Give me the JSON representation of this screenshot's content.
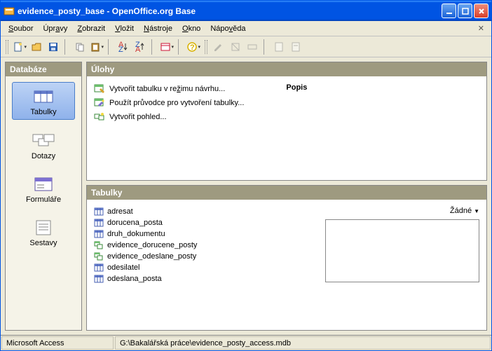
{
  "title": "evidence_posty_base - OpenOffice.org Base",
  "menubar": [
    "Soubor",
    "Úpravy",
    "Zobrazit",
    "Vložit",
    "Nástroje",
    "Okno",
    "Nápověda"
  ],
  "left": {
    "header": "Databáze",
    "items": [
      {
        "label": "Tabulky",
        "selected": true
      },
      {
        "label": "Dotazy"
      },
      {
        "label": "Formuláře"
      },
      {
        "label": "Sestavy"
      }
    ]
  },
  "tasks": {
    "header": "Úlohy",
    "items": [
      "Vytvořit tabulku v režimu návrhu...",
      "Použít průvodce pro vytvoření tabulky...",
      "Vytvořit pohled..."
    ],
    "popis_label": "Popis"
  },
  "tables": {
    "header": "Tabulky",
    "items": [
      {
        "name": "adresat",
        "type": "table"
      },
      {
        "name": "dorucena_posta",
        "type": "table"
      },
      {
        "name": "druh_dokumentu",
        "type": "table"
      },
      {
        "name": "evidence_dorucene_posty",
        "type": "query"
      },
      {
        "name": "evidence_odeslane_posty",
        "type": "query"
      },
      {
        "name": "odesilatel",
        "type": "table"
      },
      {
        "name": "odeslana_posta",
        "type": "table"
      }
    ],
    "preview_label": "Žádné"
  },
  "statusbar": {
    "engine": "Microsoft Access",
    "path": "G:\\Bakalářská práce\\evidence_posty_access.mdb"
  }
}
